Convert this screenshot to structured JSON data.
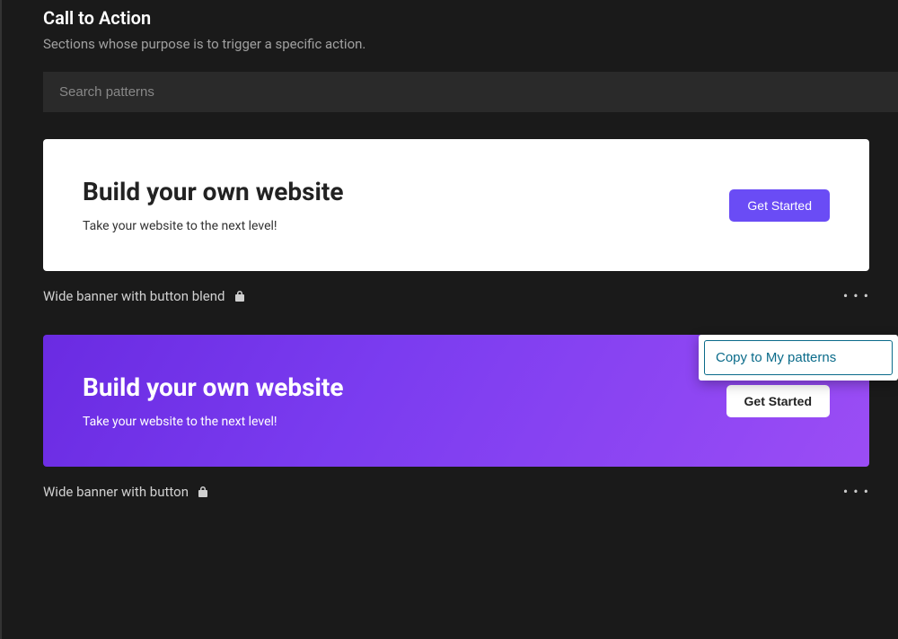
{
  "header": {
    "title": "Call to Action",
    "subtitle": "Sections whose purpose is to trigger a specific action."
  },
  "search": {
    "placeholder": "Search patterns",
    "value": ""
  },
  "patterns": [
    {
      "title": "Build your own website",
      "subtitle": "Take your website to the next level!",
      "button_label": "Get Started",
      "name": "Wide banner with button blend",
      "locked": true
    },
    {
      "title": "Build your own website",
      "subtitle": "Take your website to the next level!",
      "button_label": "Get Started",
      "name": "Wide banner with button",
      "locked": true
    }
  ],
  "popover": {
    "action_label": "Copy to My patterns"
  }
}
